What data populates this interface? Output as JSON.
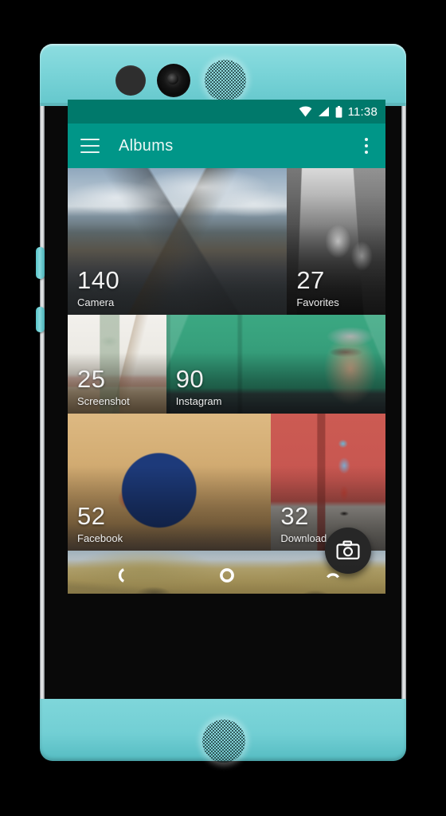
{
  "device": {
    "name": "nextbit-robin-phone",
    "body_color": "#7ad4d8",
    "bezel_color": "#090909",
    "components": {
      "proximity_sensor": "proximity-sensor",
      "front_camera": "front-camera-lens",
      "top_speaker": "top-speaker-grille",
      "bottom_speaker": "bottom-speaker-grille",
      "volume_button": "volume-button",
      "power_button": "power-button"
    }
  },
  "statusbar": {
    "time": "11:38",
    "icons": [
      "wifi-icon",
      "cellular-signal-icon",
      "battery-full-icon"
    ],
    "background": "#00796b"
  },
  "appbar": {
    "menu_icon": "hamburger-menu-icon",
    "title": "Albums",
    "overflow_icon": "overflow-menu-icon",
    "background": "#009688"
  },
  "albums": [
    {
      "count": "140",
      "name": "Camera",
      "art": "art-mountain",
      "flex": 69
    },
    {
      "count": "27",
      "name": "Favorites",
      "art": "art-bw",
      "flex": 31
    },
    {
      "count": "25",
      "name": "Screenshot",
      "art": "art-interior",
      "flex": 31
    },
    {
      "count": "90",
      "name": "Instagram",
      "art": "art-greendoor",
      "flex": 69
    },
    {
      "count": "52",
      "name": "Facebook",
      "art": "art-fruit",
      "flex": 64
    },
    {
      "count": "32",
      "name": "Download",
      "art": "art-child",
      "flex": 36
    }
  ],
  "partial_row": {
    "art": "art-field"
  },
  "fab": {
    "icon": "camera-icon",
    "label": "Open camera",
    "background": "#272727"
  },
  "navbar": {
    "back": "back-nav-icon",
    "home": "home-nav-icon",
    "recents": "recents-nav-icon"
  }
}
